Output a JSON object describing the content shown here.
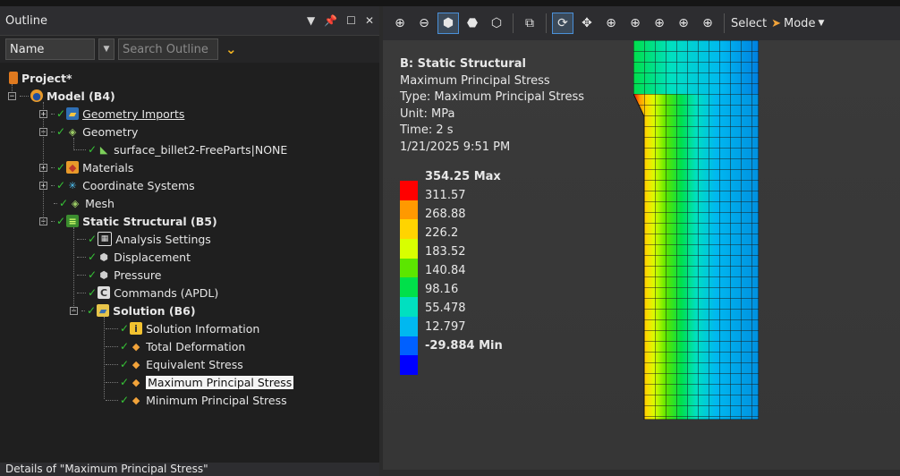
{
  "outline": {
    "title": "Outline",
    "filter_name": "Name",
    "search_placeholder": "Search Outline",
    "tree": [
      {
        "label": "Project*",
        "bold": true
      },
      {
        "label": "Model (B4)",
        "bold": true
      },
      {
        "label": "Geometry Imports"
      },
      {
        "label": "Geometry"
      },
      {
        "label": "surface_billet2-FreeParts|NONE"
      },
      {
        "label": "Materials"
      },
      {
        "label": "Coordinate Systems"
      },
      {
        "label": "Mesh"
      },
      {
        "label": "Static Structural (B5)",
        "bold": true
      },
      {
        "label": "Analysis Settings"
      },
      {
        "label": "Displacement"
      },
      {
        "label": "Pressure"
      },
      {
        "label": "Commands (APDL)"
      },
      {
        "label": "Solution (B6)",
        "bold": true
      },
      {
        "label": "Solution Information"
      },
      {
        "label": "Total Deformation"
      },
      {
        "label": "Equivalent Stress"
      },
      {
        "label": "Maximum Principal Stress",
        "selected": true
      },
      {
        "label": "Minimum Principal Stress"
      }
    ]
  },
  "details": {
    "title": "Details of \"Maximum Principal Stress\""
  },
  "toolbar": {
    "select_label": "Select",
    "mode_label": "Mode"
  },
  "result": {
    "title": "B: Static Structural",
    "name": "Maximum Principal Stress",
    "type": "Type: Maximum Principal Stress",
    "unit": "Unit: MPa",
    "time": "Time: 2 s",
    "date": "1/21/2025 9:51 PM"
  },
  "legend": {
    "labels": [
      "354.25 Max",
      "311.57",
      "268.88",
      "226.2",
      "183.52",
      "140.84",
      "98.16",
      "55.478",
      "12.797",
      "-29.884 Min"
    ],
    "colors": [
      "#ff0000",
      "#ff9900",
      "#ffd400",
      "#d8ff00",
      "#5ce600",
      "#00e04a",
      "#00e0c0",
      "#00b8f0",
      "#0060ff",
      "#0000ff"
    ]
  }
}
